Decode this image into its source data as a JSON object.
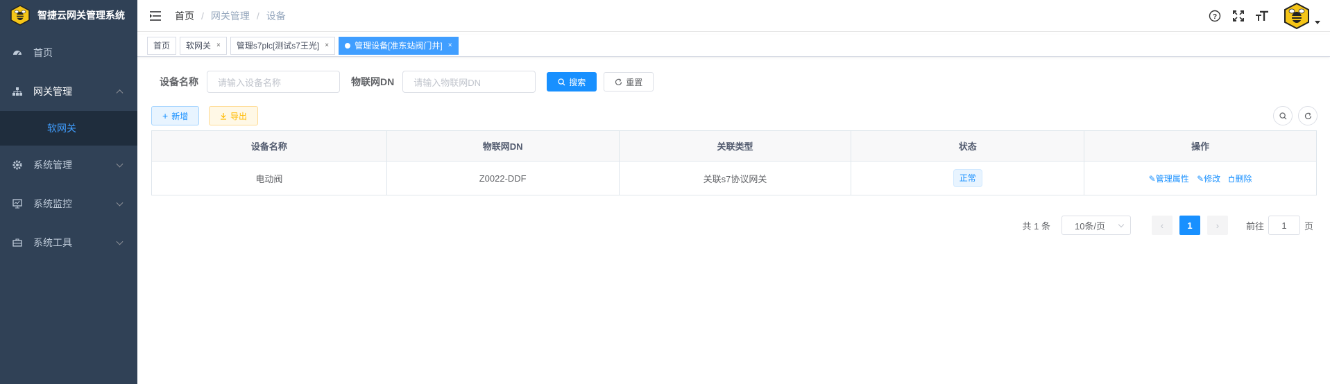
{
  "app": {
    "title": "智捷云网关管理系统"
  },
  "sidebar": {
    "items": [
      {
        "label": "首页",
        "icon": "dashboard-icon"
      },
      {
        "label": "网关管理",
        "icon": "tree-icon",
        "expanded": true
      },
      {
        "label": "系统管理",
        "icon": "gear-icon"
      },
      {
        "label": "系统监控",
        "icon": "monitor-icon"
      },
      {
        "label": "系统工具",
        "icon": "toolbox-icon"
      }
    ],
    "submenu": {
      "label": "软网关"
    }
  },
  "breadcrumb": {
    "home": "首页",
    "section": "网关管理",
    "current": "设备"
  },
  "tags": [
    {
      "label": "首页",
      "closable": false
    },
    {
      "label": "软网关",
      "closable": true
    },
    {
      "label": "管理s7plc[测试s7王光]",
      "closable": true
    },
    {
      "label": "管理设备[准东站阀门井]",
      "closable": true,
      "active": true
    }
  ],
  "tag_close": "×",
  "search": {
    "device_name_label": "设备名称",
    "device_name_placeholder": "请输入设备名称",
    "dn_label": "物联网DN",
    "dn_placeholder": "请输入物联网DN",
    "search_button": "搜索",
    "reset_button": "重置"
  },
  "toolbar": {
    "add_button": "新增",
    "export_button": "导出"
  },
  "table": {
    "headers": [
      "设备名称",
      "物联网DN",
      "关联类型",
      "状态",
      "操作"
    ],
    "rows": [
      {
        "name": "电动阀",
        "dn": "Z0022-DDF",
        "type": "关联s7协议网关",
        "status": "正常"
      }
    ],
    "actions": {
      "manage": "管理属性",
      "edit": "修改",
      "delete": "删除"
    }
  },
  "pagination": {
    "total_text": "共 1 条",
    "page_size": "10条/页",
    "current_page": "1",
    "goto_label": "前往",
    "goto_value": "1",
    "page_suffix": "页"
  },
  "colors": {
    "sidebar": "#304156",
    "primary": "#1890ff",
    "warning": "#ffba00"
  }
}
